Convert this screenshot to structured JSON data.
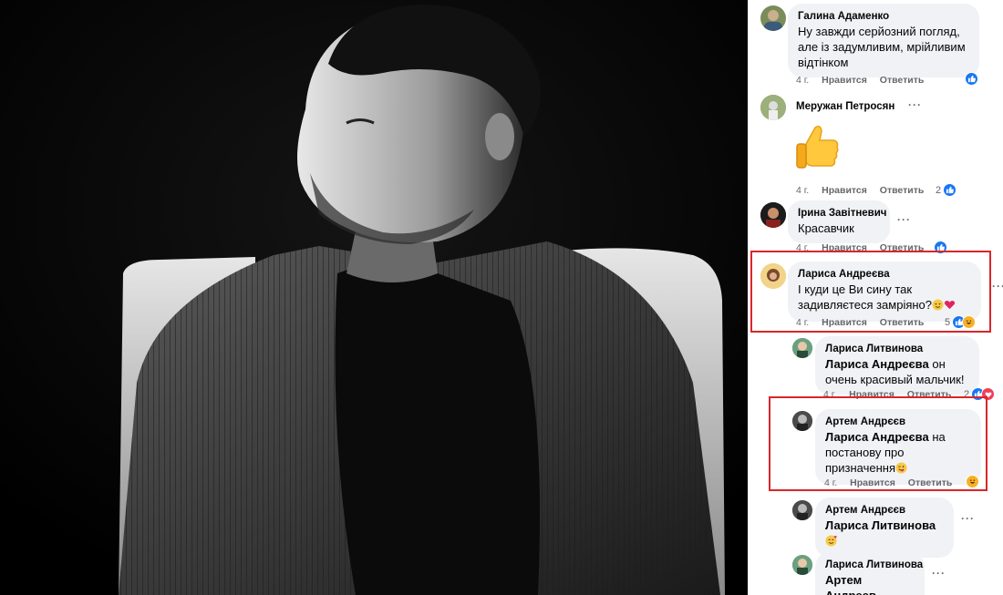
{
  "comments": [
    {
      "author": "Галина Адаменко",
      "text": "Ну завжди серйозний погляд, але із задумливим, мрійливим відтінком",
      "age": "4 г.",
      "like": "Нравится",
      "reply": "Ответить",
      "reactions": "",
      "avatar_icon": "user-avatar-photo"
    },
    {
      "author": "Меружан Петросян",
      "text": "",
      "sticker": "thumbs-up-emoji",
      "age": "4 г.",
      "like": "Нравится",
      "reply": "Ответить",
      "reactions": "2",
      "more": "···"
    },
    {
      "author": "Ірина Завітневич",
      "text": "Красавчик",
      "age": "4 г.",
      "like": "Нравится",
      "reply": "Ответить",
      "reactions": "",
      "more": "···"
    },
    {
      "author": "Лариса Андреєва",
      "text": "І куди це Ви сину так задивляєтеся замріяно?",
      "age": "4 г.",
      "like": "Нравится",
      "reply": "Ответить",
      "reactions": "5",
      "more": "···",
      "highlight_color": "#d9262c"
    },
    {
      "author": "Лариса Литвинова",
      "mention": "Лариса Андреєва",
      "text": "он очень красивый мальчик!",
      "age": "4 г.",
      "like": "Нравится",
      "reply": "Ответить",
      "reactions": "2"
    },
    {
      "author": "Артем Андрєєв",
      "mention": "Лариса Андреєва",
      "text": "на постанову про призначення",
      "age": "4 г.",
      "like": "Нравится",
      "reply": "Ответить",
      "reactions": "",
      "highlight_color": "#d9262c"
    },
    {
      "author": "Артем Андрєєв",
      "mention": "Лариса Литвинова",
      "text": "",
      "age": "",
      "more": "···"
    },
    {
      "author": "Лариса Литвинова",
      "mention": "Артем Андреев",
      "text": "",
      "age": "",
      "more": "···"
    }
  ],
  "colors": {
    "like_blue": "#1877f2",
    "heart_red": "#f33e58",
    "haha_yellow": "#f7b125",
    "bubble_bg": "#f0f2f5",
    "meta_gray": "#65676b"
  }
}
